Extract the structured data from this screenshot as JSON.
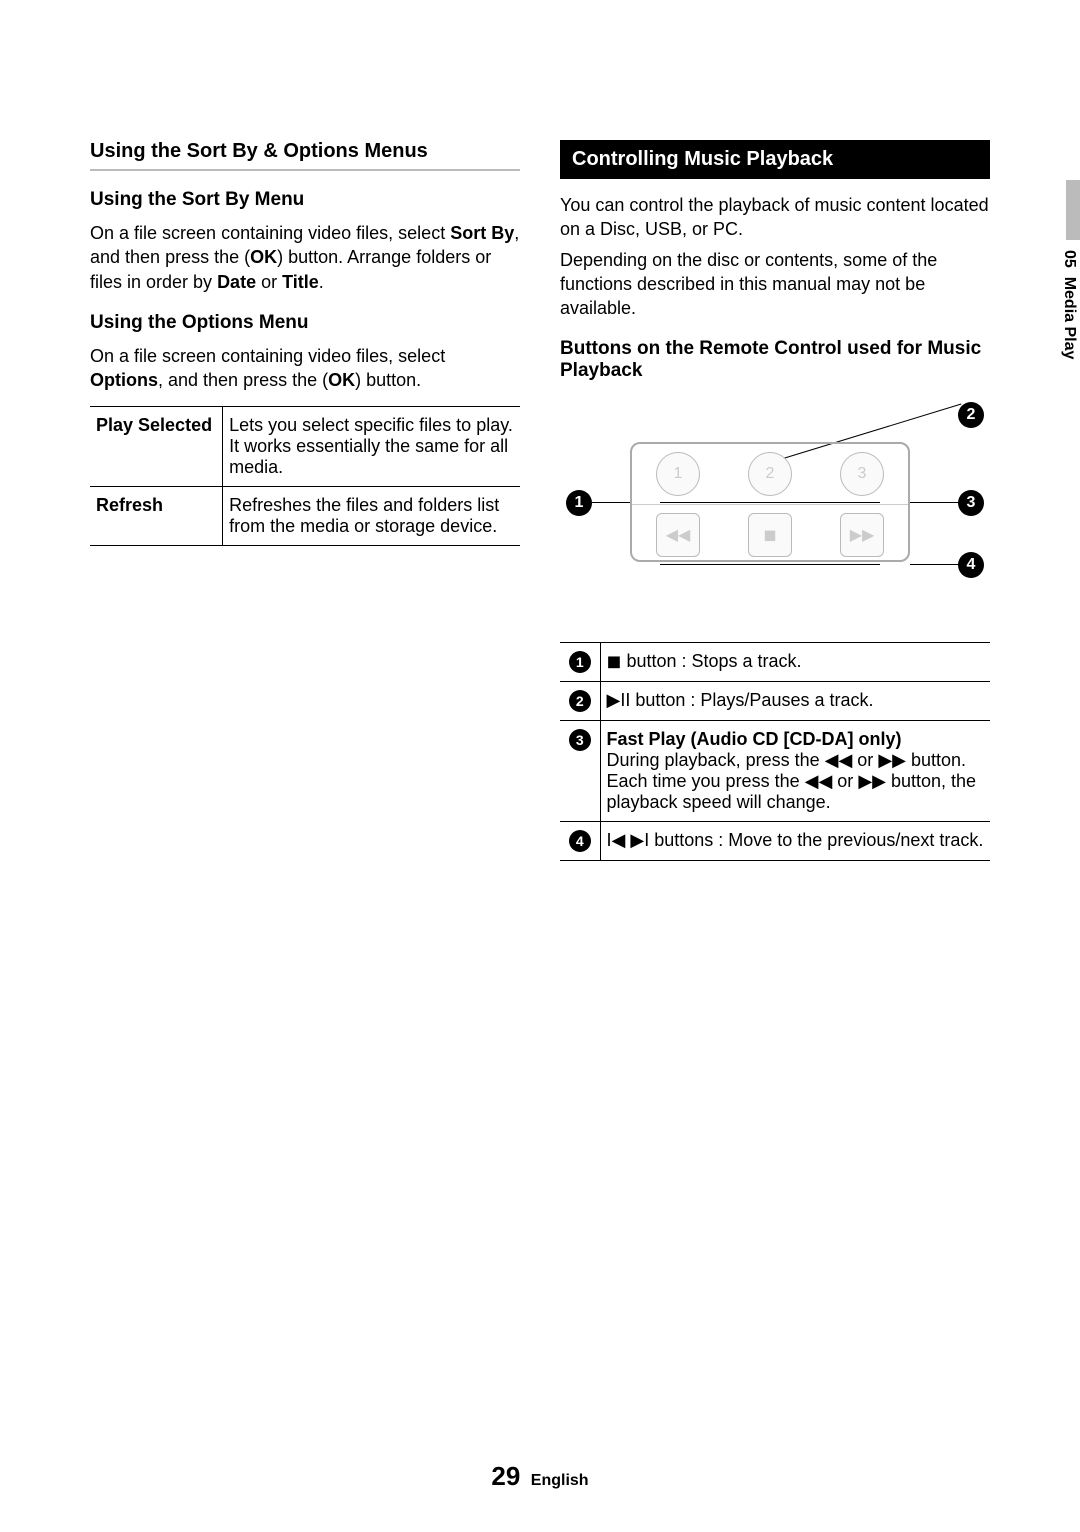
{
  "side_tab": {
    "chapter_num": "05",
    "chapter_name": "Media Play"
  },
  "left": {
    "section_title": "Using the Sort By & Options Menus",
    "sortby_title": "Using the Sort By Menu",
    "sortby_p_a": "On a file screen containing video files, select ",
    "sortby_sort": "Sort By",
    "sortby_p_b": ", and then press the ",
    "sortby_ok": "OK",
    "sortby_p_c": ") button. Arrange folders or files in order by ",
    "sortby_date": "Date",
    "sortby_or": " or ",
    "sortby_titleword": "Title",
    "sortby_dot": ".",
    "options_title": "Using the Options Menu",
    "options_p_a": "On a file screen containing video files, select ",
    "options_word": "Options",
    "options_p_b": ", and then press the ",
    "options_ok": "OK",
    "options_p_c": ") button.",
    "table": {
      "r1_label": "Play Selected",
      "r1_desc": "Lets you select specific files to play. It works essentially the same for all media.",
      "r2_label": "Refresh",
      "r2_desc": "Refreshes the files and folders list from the media or storage device."
    }
  },
  "right": {
    "heading": "Controlling Music Playback",
    "p1": "You can control the playback of music content located on a Disc, USB, or PC.",
    "p2": "Depending on the disc or contents, some of the functions described in this manual may not be available.",
    "sub": "Buttons on the Remote Control used for Music Playback",
    "remote": {
      "row1": [
        "1",
        "2",
        "3"
      ],
      "row2": [
        "◀◀",
        "◼",
        "▶▶"
      ]
    },
    "callouts": {
      "c1": "1",
      "c2": "2",
      "c3": "3",
      "c4": "4"
    },
    "desc": [
      {
        "n": "1",
        "icon": "◼",
        "text": " button : Stops a track."
      },
      {
        "n": "2",
        "icon": "▶II",
        "text": " button : Plays/Pauses a track."
      },
      {
        "n": "3",
        "bold": "Fast Play (Audio CD [CD-DA] only)",
        "line2a": "During playback, press the ",
        "rw": "◀◀",
        "or": " or ",
        "ff": "▶▶",
        "line2b": " button.",
        "line3a": "Each time you press the ",
        "line3b": " button, the playback speed will change."
      },
      {
        "n": "4",
        "icon": "I◀ ▶I",
        "text": " buttons : Move to the previous/next track."
      }
    ]
  },
  "footer": {
    "page": "29",
    "lang": "English"
  }
}
